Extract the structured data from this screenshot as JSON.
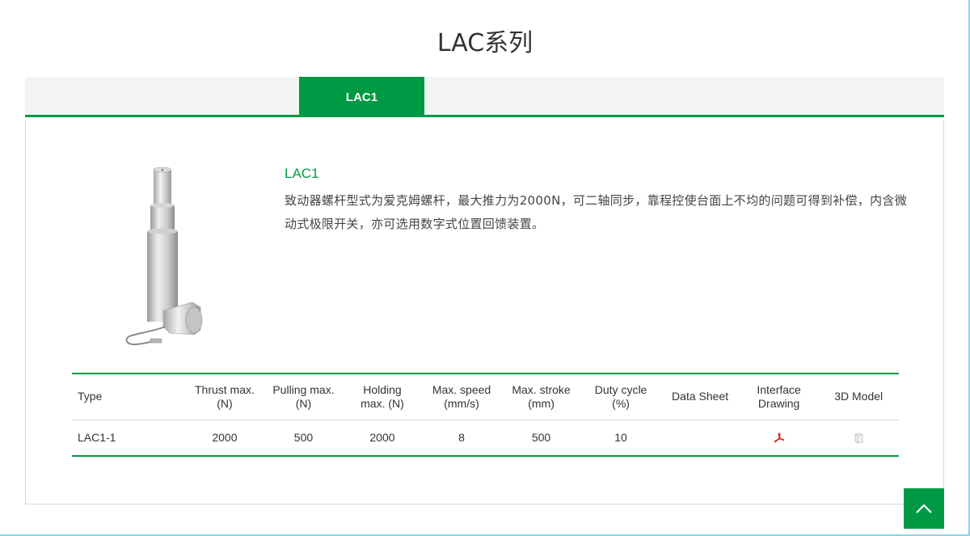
{
  "page": {
    "title": "LAC系列"
  },
  "tabs": [
    {
      "label": "LAC1",
      "active": true
    }
  ],
  "product": {
    "name": "LAC1",
    "description": "致动器螺杆型式为爱克姆螺杆，最大推力为2000N，可二轴同步，靠程控使台面上不均的问题可得到补偿，内含微动式极限开关，亦可选用数字式位置回馈装置。"
  },
  "table": {
    "headers": {
      "type": "Type",
      "thrust_l1": "Thrust max.",
      "thrust_l2": "(N)",
      "pulling_l1": "Pulling max.",
      "pulling_l2": "(N)",
      "holding_l1": "Holding",
      "holding_l2": "max. (N)",
      "speed_l1": "Max. speed",
      "speed_l2": "(mm/s)",
      "stroke_l1": "Max. stroke",
      "stroke_l2": "(mm)",
      "duty_l1": "Duty cycle",
      "duty_l2": "(%)",
      "datasheet": "Data Sheet",
      "interface_l1": "Interface",
      "interface_l2": "Drawing",
      "model": "3D Model"
    },
    "rows": [
      {
        "type": "LAC1-1",
        "thrust": "2000",
        "pulling": "500",
        "holding": "2000",
        "speed": "8",
        "stroke": "500",
        "duty": "10",
        "datasheet": ""
      }
    ]
  },
  "icons": {
    "interface_drawing": "pdf-icon",
    "model_3d": "3d-model-icon",
    "scroll_top": "chevron-up-icon"
  },
  "colors": {
    "accent": "#009944",
    "tab_bar": "#f3f3f3",
    "pdf": "#d9261c"
  }
}
